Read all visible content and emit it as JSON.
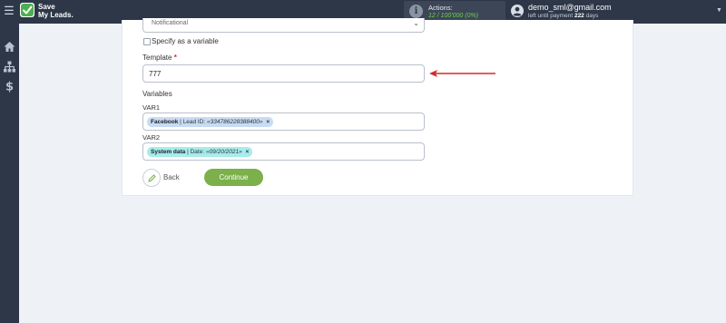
{
  "header": {
    "logo_line1": "Save",
    "logo_line2": "My Leads.",
    "actions_label": "Actions:",
    "actions_value": "12 / 100'000 (0%)",
    "user_email": "demo_sml@gmail.com",
    "user_sub_prefix": "left until payment",
    "user_sub_days": "222",
    "user_sub_suffix": "days"
  },
  "sidebar": {
    "items": [
      {
        "icon": "home-icon"
      },
      {
        "icon": "sitemap-icon"
      },
      {
        "icon": "dollar-icon"
      }
    ]
  },
  "form": {
    "select_value": "Notificational",
    "specify_variable_label": "Specify as a variable",
    "template_label": "Template",
    "template_required_mark": "*",
    "template_value": "777",
    "variables_heading": "Variables",
    "var1_label": "VAR1",
    "var1_tag_source": "Facebook",
    "var1_tag_field": "| Lead ID: ",
    "var1_tag_value": "«334786228388400»",
    "var2_label": "VAR2",
    "var2_tag_source": "System data",
    "var2_tag_field": "| Date: ",
    "var2_tag_value": "«09/20/2021»",
    "tag_remove": "×",
    "back_label": "Back",
    "continue_label": "Continue"
  },
  "colors": {
    "topbar": "#2d3748",
    "continue": "#7bb04a",
    "arrow": "#d42a2a",
    "tag_blue": "#c7dcf4",
    "tag_teal": "#a7ecec"
  }
}
